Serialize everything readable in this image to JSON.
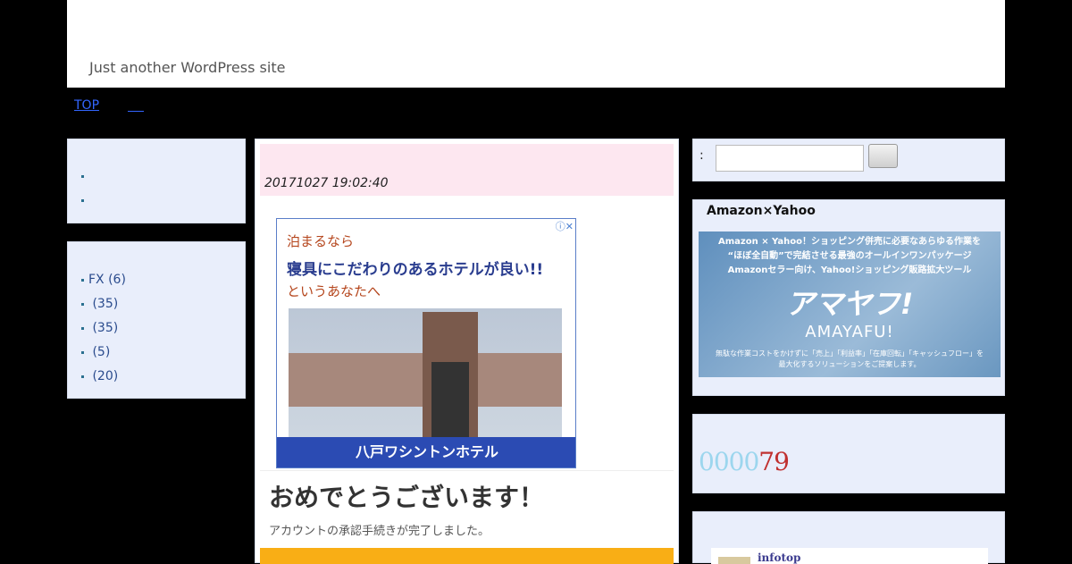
{
  "site": {
    "tagline": "Just another WordPress site"
  },
  "nav": {
    "items": [
      "TOP"
    ]
  },
  "left_box2": {
    "items": [
      "FX (6)",
      "(35)",
      "(35)",
      "(5)",
      "(20)"
    ]
  },
  "post": {
    "date": "20171027 19:02:40",
    "ad": {
      "line1": "泊まるなら",
      "line2": "寝具にこだわりのあるホテルが良い!!",
      "line3": "というあなたへ",
      "footer": "八戸ワシントンホテル",
      "info_icon": "ⓘ✕"
    },
    "congrats_title": "おめでとうございます！",
    "congrats_sub": "アカウントの承認手続きが完了しました。"
  },
  "search": {
    "colon": ":"
  },
  "amazon": {
    "title": "Amazon×Yahoo",
    "banner_line1": "Amazon × Yahoo！ショッピング併売に必要なあらゆる作業を",
    "banner_line2": "“ほぼ全自動”で完結させる最強のオールインワンパッケージ",
    "banner_line3": "Amazonセラー向け、Yahoo!ショッピング販路拡大ツール",
    "logo": "アマヤフ!",
    "logo_latin": "AMAYAFU!",
    "banner_line4": "無駄な作業コストをかけずに「売上」「利益率」「在庫回転」「キャッシュフロー」を",
    "banner_line5": "最大化するソリューションをご提案します。"
  },
  "counter": {
    "digits_light": "0000",
    "digits_red": "79"
  },
  "infotop": {
    "label": "infotop"
  },
  "colors": {
    "accent_link": "#3366ff",
    "date_bg": "#fde7f0",
    "sidebar_bg": "#e9eefb"
  }
}
